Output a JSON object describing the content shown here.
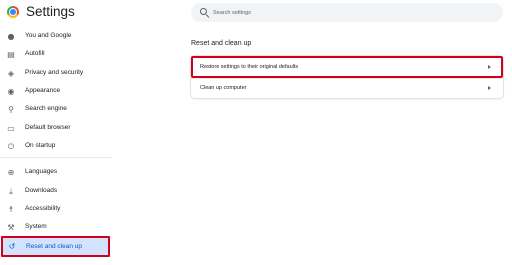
{
  "app": {
    "title": "Settings",
    "logo_icon": "chrome-logo-icon"
  },
  "search": {
    "placeholder": "Search settings"
  },
  "sidebar": {
    "items": [
      {
        "label": "You and Google",
        "icon": "person-icon"
      },
      {
        "label": "Autofill",
        "icon": "clipboard-icon"
      },
      {
        "label": "Privacy and security",
        "icon": "shield-icon"
      },
      {
        "label": "Appearance",
        "icon": "palette-icon"
      },
      {
        "label": "Search engine",
        "icon": "search-icon"
      },
      {
        "label": "Default browser",
        "icon": "browser-window-icon"
      },
      {
        "label": "On startup",
        "icon": "power-icon"
      },
      {
        "label": "Languages",
        "icon": "globe-icon"
      },
      {
        "label": "Downloads",
        "icon": "download-icon"
      },
      {
        "label": "Accessibility",
        "icon": "accessibility-icon"
      },
      {
        "label": "System",
        "icon": "wrench-icon"
      },
      {
        "label": "Reset and clean up",
        "icon": "reset-history-icon",
        "active": true
      }
    ]
  },
  "main": {
    "section_title": "Reset and clean up",
    "rows": [
      {
        "label": "Restore settings to their original defaults",
        "highlighted": true
      },
      {
        "label": "Clean up computer"
      }
    ]
  },
  "colors": {
    "highlight_border": "#d0021b",
    "active_bg": "#d3e3fd",
    "active_text": "#0b57d0"
  }
}
